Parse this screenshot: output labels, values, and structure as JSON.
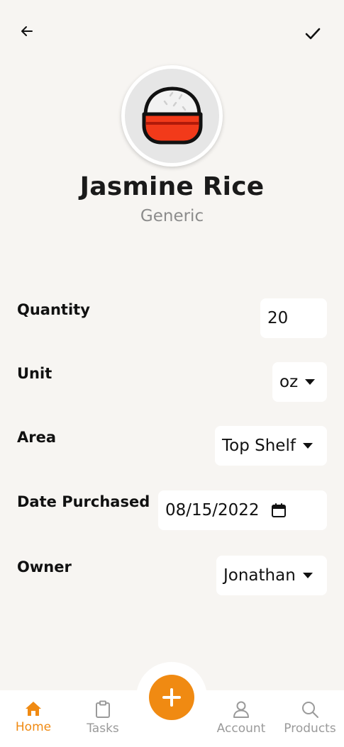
{
  "header": {
    "back_icon": "arrow-left-icon",
    "save_icon": "checkmark-icon"
  },
  "product": {
    "avatar_icon": "rice-bowl-icon",
    "name": "Jasmine Rice",
    "brand": "Generic"
  },
  "form": {
    "quantity": {
      "label": "Quantity",
      "value": "20"
    },
    "unit": {
      "label": "Unit",
      "value": "oz"
    },
    "area": {
      "label": "Area",
      "value": "Top Shelf"
    },
    "date_purchased": {
      "label": "Date Purchased",
      "value": "08/15/2022"
    },
    "owner": {
      "label": "Owner",
      "value": "Jonathan"
    }
  },
  "nav": {
    "home": {
      "label": "Home",
      "icon": "home-icon"
    },
    "tasks": {
      "label": "Tasks",
      "icon": "clipboard-icon"
    },
    "add": {
      "icon": "plus-icon"
    },
    "account": {
      "label": "Account",
      "icon": "user-icon"
    },
    "products": {
      "label": "Products",
      "icon": "search-icon"
    }
  },
  "colors": {
    "accent": "#f08a12",
    "background": "#f7f5f2",
    "bowl": "#f23a1a"
  }
}
